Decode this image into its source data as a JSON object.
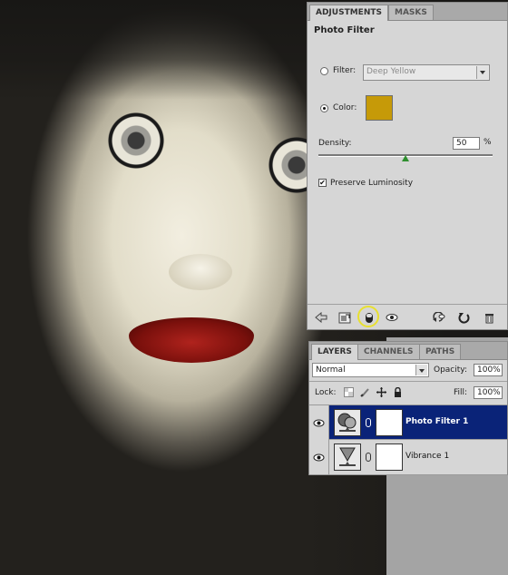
{
  "adjustments_panel": {
    "tabs": [
      {
        "label": "ADJUSTMENTS",
        "active": true
      },
      {
        "label": "MASKS",
        "active": false
      }
    ],
    "title": "Photo Filter",
    "filter": {
      "label": "Filter:",
      "selected": false,
      "value": "Deep Yellow"
    },
    "color": {
      "label": "Color:",
      "selected": true,
      "swatch": "#c69a08"
    },
    "density": {
      "label": "Density:",
      "value": "50",
      "unit": "%",
      "fraction": 0.5
    },
    "preserve_luminosity": {
      "label": "Preserve Luminosity",
      "checked": true
    },
    "bottom_icons": [
      "back-arrow-icon",
      "expand-view-icon",
      "clip-to-layer-icon",
      "visibility-eye-icon",
      "view-previous-icon",
      "reset-icon",
      "trash-icon"
    ],
    "highlight_color": "#e8e030"
  },
  "layers_panel": {
    "tabs": [
      {
        "label": "LAYERS",
        "active": true
      },
      {
        "label": "CHANNELS",
        "active": false
      },
      {
        "label": "PATHS",
        "active": false
      }
    ],
    "blend_mode": "Normal",
    "opacity": {
      "label": "Opacity:",
      "value": "100%"
    },
    "lock": {
      "label": "Lock:"
    },
    "fill": {
      "label": "Fill:",
      "value": "100%"
    },
    "layers": [
      {
        "name": "Photo Filter 1",
        "selected": true,
        "thumb_icon": "photo-filter-icon"
      },
      {
        "name": "Vibrance 1",
        "selected": false,
        "thumb_icon": "vibrance-icon"
      }
    ],
    "selection_color": "#0a2378"
  }
}
